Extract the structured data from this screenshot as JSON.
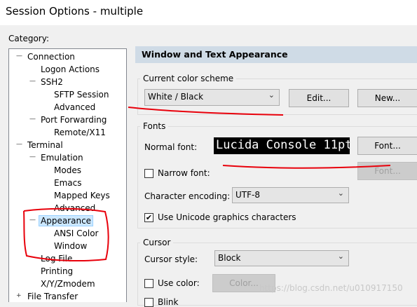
{
  "window": {
    "title": "Session Options - multiple"
  },
  "category_label": "Category:",
  "tree": [
    {
      "label": "Connection",
      "expander": "-"
    },
    {
      "label": "Logon Actions"
    },
    {
      "label": "SSH2",
      "expander": "-"
    },
    {
      "label": "SFTP Session"
    },
    {
      "label": "Advanced"
    },
    {
      "label": "Port Forwarding",
      "expander": "-"
    },
    {
      "label": "Remote/X11"
    },
    {
      "label": "Terminal",
      "expander": "-"
    },
    {
      "label": "Emulation",
      "expander": "-"
    },
    {
      "label": "Modes"
    },
    {
      "label": "Emacs"
    },
    {
      "label": "Mapped Keys"
    },
    {
      "label": "Advanced"
    },
    {
      "label": "Appearance",
      "expander": "-",
      "selected": true
    },
    {
      "label": "ANSI Color"
    },
    {
      "label": "Window"
    },
    {
      "label": "Log File"
    },
    {
      "label": "Printing"
    },
    {
      "label": "X/Y/Zmodem"
    },
    {
      "label": "File Transfer",
      "expander": "+"
    }
  ],
  "panel": {
    "header": "Window and Text Appearance",
    "color_scheme": {
      "group_title": "Current color scheme",
      "selected": "White / Black",
      "edit_button": "Edit...",
      "new_button": "New..."
    },
    "fonts": {
      "group_title": "Fonts",
      "normal_font_label": "Normal font:",
      "normal_font_preview": "Lucida Console 11pt",
      "font_button": "Font...",
      "narrow_font_label": "Narrow font:",
      "narrow_font_checked": false,
      "narrow_font_button": "Font...",
      "encoding_label": "Character encoding:",
      "encoding_value": "UTF-8",
      "unicode_label": "Use Unicode graphics characters",
      "unicode_checked": true
    },
    "cursor": {
      "group_title": "Cursor",
      "style_label": "Cursor style:",
      "style_value": "Block",
      "use_color_label": "Use color:",
      "use_color_checked": false,
      "color_button": "Color...",
      "blink_label": "Blink"
    }
  },
  "watermark": "https://blog.csdn.net/u010917150",
  "colors": {
    "annotation": "#e8000b",
    "header_bg": "#cfdbe6",
    "selection": "#cce8ff"
  },
  "icons": {
    "checked": "✔",
    "dropdown": "⌄"
  }
}
